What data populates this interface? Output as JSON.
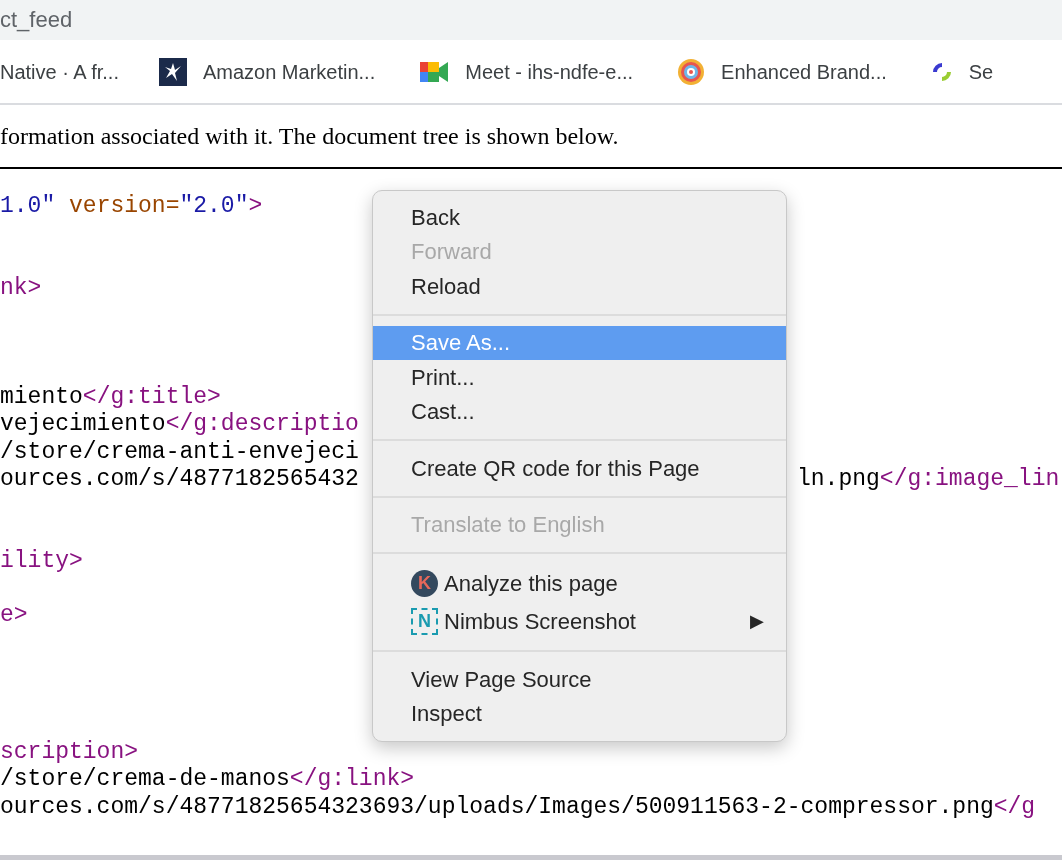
{
  "address_bar": {
    "text": "ct_feed"
  },
  "bookmarks": [
    {
      "label": "Native · A fr...",
      "kind": "none"
    },
    {
      "label": "Amazon Marketin...",
      "kind": "dark-square"
    },
    {
      "label": "Meet - ihs-ndfe-e...",
      "kind": "camera"
    },
    {
      "label": "Enhanced Brand...",
      "kind": "target"
    },
    {
      "label": "Se",
      "kind": "ring"
    }
  ],
  "intro": "formation associated with it. The document tree is shown below.",
  "code_lines": [
    {
      "kind": "code",
      "left": [
        {
          "t": "1.0\"",
          "kind": "value"
        },
        {
          "t": " version",
          "kind": "attr"
        },
        {
          "t": "=",
          "kind": "attr"
        },
        {
          "t": "\"2.0\"",
          "kind": "value"
        },
        {
          "t": ">",
          "kind": "tag"
        }
      ]
    },
    {
      "kind": "blank"
    },
    {
      "kind": "blank"
    },
    {
      "kind": "code",
      "left": [
        {
          "t": "nk>",
          "kind": "tag"
        }
      ]
    },
    {
      "kind": "blank"
    },
    {
      "kind": "blank"
    },
    {
      "kind": "blank"
    },
    {
      "kind": "code",
      "left": [
        {
          "t": "miento",
          "kind": "text"
        },
        {
          "t": "</g:title>",
          "kind": "tag"
        }
      ]
    },
    {
      "kind": "code",
      "left": [
        {
          "t": "vejecimiento",
          "kind": "text"
        },
        {
          "t": "</g:descriptio",
          "kind": "tag"
        }
      ]
    },
    {
      "kind": "code",
      "left": [
        {
          "t": "/store/crema-anti-envejeci",
          "kind": "text"
        }
      ]
    },
    {
      "kind": "code",
      "left": [
        {
          "t": "ources.com/s/4877182565432",
          "kind": "text"
        }
      ],
      "right": [
        {
          "t": "ln.png",
          "kind": "text"
        },
        {
          "t": "</g:image_lin",
          "kind": "tag"
        }
      ]
    },
    {
      "kind": "blank"
    },
    {
      "kind": "blank"
    },
    {
      "kind": "code",
      "left": [
        {
          "t": "ility>",
          "kind": "tag"
        }
      ]
    },
    {
      "kind": "blank"
    },
    {
      "kind": "code",
      "left": [
        {
          "t": "e>",
          "kind": "tag"
        }
      ]
    },
    {
      "kind": "blank"
    },
    {
      "kind": "blank"
    },
    {
      "kind": "blank"
    },
    {
      "kind": "blank"
    },
    {
      "kind": "code",
      "left": [
        {
          "t": "scription>",
          "kind": "tag"
        }
      ]
    },
    {
      "kind": "code",
      "left": [
        {
          "t": "/store/crema-de-manos",
          "kind": "text"
        },
        {
          "t": "</g:link>",
          "kind": "tag"
        }
      ]
    },
    {
      "kind": "code",
      "left": [
        {
          "t": "ources.com/s/48771825654323693/uploads/Images/500911563-2-compressor.png",
          "kind": "text"
        },
        {
          "t": "</g",
          "kind": "tag"
        }
      ]
    }
  ],
  "context_menu": {
    "groups": [
      [
        {
          "label": "Back",
          "disabled": false,
          "selected": false
        },
        {
          "label": "Forward",
          "disabled": true,
          "selected": false
        },
        {
          "label": "Reload",
          "disabled": false,
          "selected": false
        }
      ],
      [
        {
          "label": "Save As...",
          "disabled": false,
          "selected": true
        },
        {
          "label": "Print...",
          "disabled": false,
          "selected": false
        },
        {
          "label": "Cast...",
          "disabled": false,
          "selected": false
        }
      ],
      [
        {
          "label": "Create QR code for this Page",
          "disabled": false,
          "selected": false
        }
      ],
      [
        {
          "label": "Translate to English",
          "disabled": true,
          "selected": false
        }
      ],
      [
        {
          "label": "Analyze this page",
          "disabled": false,
          "selected": false,
          "icon": {
            "kind": "round",
            "glyph": "K"
          }
        },
        {
          "label": "Nimbus Screenshot",
          "disabled": false,
          "selected": false,
          "icon": {
            "kind": "dashed",
            "glyph": "N"
          },
          "submenu": "▶"
        }
      ],
      [
        {
          "label": "View Page Source",
          "disabled": false,
          "selected": false
        },
        {
          "label": "Inspect",
          "disabled": false,
          "selected": false
        }
      ]
    ]
  }
}
